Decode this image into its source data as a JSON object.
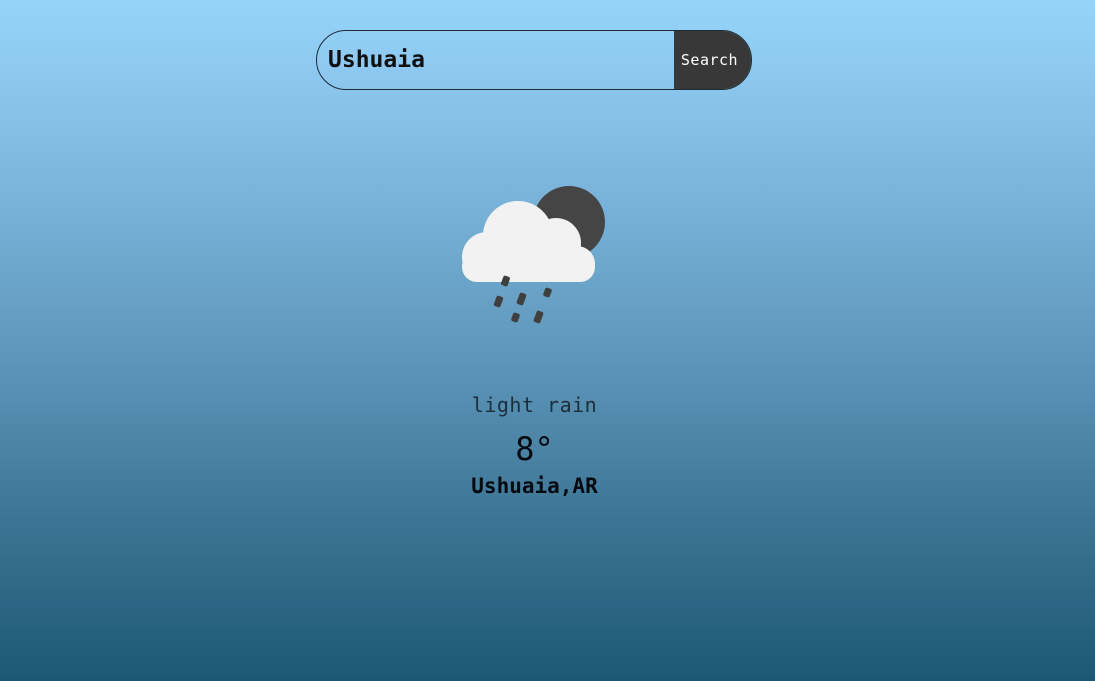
{
  "search": {
    "value": "Ushuaia",
    "button_label": "Search"
  },
  "weather": {
    "icon": "cloud-rain-moon-icon",
    "description": "light rain",
    "temperature": "8°",
    "location": "Ushuaia,AR"
  },
  "colors": {
    "gradient_top": "#96d4fb",
    "gradient_bottom": "#1c5876",
    "button_bg": "#383838",
    "moon": "#464546",
    "cloud": "#f2f2f2",
    "rain": "#3f3f3f"
  }
}
